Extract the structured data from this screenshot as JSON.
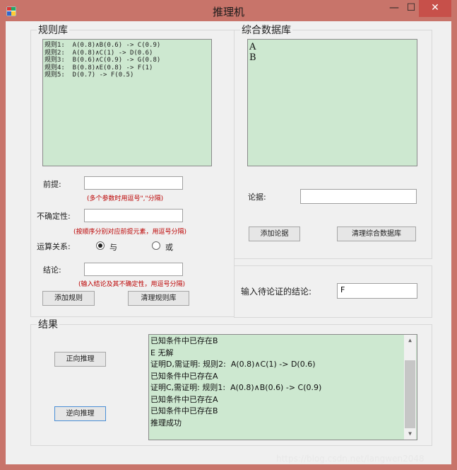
{
  "window": {
    "title": "推理机",
    "min": "—",
    "max": "☐",
    "close": "✕"
  },
  "rules": {
    "group_title": "规则库",
    "text": "规则1:  A(0.8)∧B(0.6) -> C(0.9)\n规则2:  A(0.8)∧C(1) -> D(0.6)\n规则3:  B(0.6)∧C(0.9) -> G(0.8)\n规则4:  B(0.8)∧E(0.8) -> F(1)\n规则5:  D(0.7) -> F(0.5)",
    "premise_label": "前提:",
    "premise_value": "",
    "premise_hint": "(多个参数时用逗号\",\"分隔)",
    "uncertainty_label": "不确定性:",
    "uncertainty_value": "",
    "uncertainty_hint": "(按顺序分别对应前提元素，用逗号分隔)",
    "relation_label": "运算关系:",
    "and_label": "与",
    "or_label": "或",
    "selected": "与",
    "conclusion_label": "结论:",
    "conclusion_value": "",
    "conclusion_hint": "(输入结论及其不确定性，用逗号分隔)",
    "add_button": "添加规则",
    "clear_button": "清理规则库"
  },
  "database": {
    "group_title": "综合数据库",
    "text": "A\nB",
    "evidence_label": "论据:",
    "evidence_value": "",
    "add_button": "添加论据",
    "clear_button": "清理综合数据库"
  },
  "goal": {
    "label": "输入待论证的结论:",
    "value": "F"
  },
  "results": {
    "group_title": "结果",
    "forward_button": "正向推理",
    "backward_button": "逆向推理",
    "text": "已知条件中已存在B\nE 无解\n证明D,需证明: 规则2:  A(0.8)∧C(1) -> D(0.6)\n已知条件中已存在A\n证明C,需证明: 规则1:  A(0.8)∧B(0.6) -> C(0.9)\n已知条件中已存在A\n已知条件中已存在B\n推理成功"
  },
  "watermark": "https://blog.csdn.net/langwen2048"
}
